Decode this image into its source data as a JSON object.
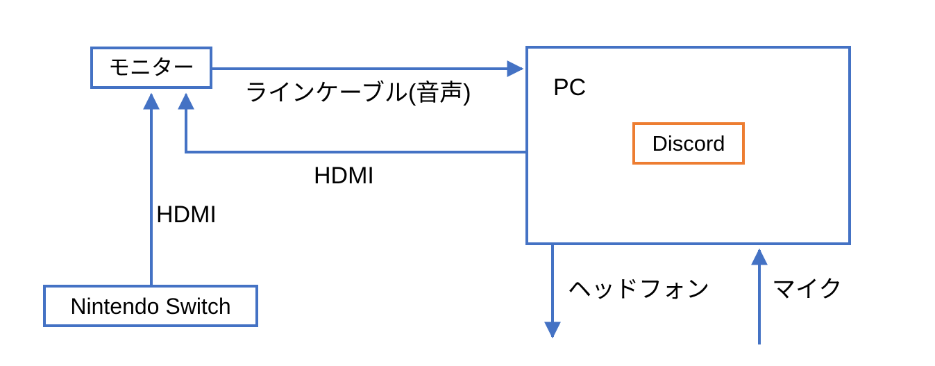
{
  "diagram": {
    "title": "PC / Monitor / Nintendo Switch connection diagram",
    "colors": {
      "box_blue": "#4472C4",
      "box_orange": "#ED7D31",
      "line_blue": "#4472C4",
      "text": "#000000",
      "background": "#FFFFFF"
    },
    "nodes": {
      "monitor": {
        "label": "モニター"
      },
      "pc": {
        "label": "PC"
      },
      "discord": {
        "label": "Discord"
      },
      "switch": {
        "label": "Nintendo Switch"
      }
    },
    "edges": {
      "line_cable_audio": {
        "label": "ラインケーブル(音声)",
        "from": "monitor",
        "to": "pc",
        "arrow": "to-pc"
      },
      "hdmi_pc_to_monitor": {
        "label": "HDMI",
        "from": "pc",
        "to": "monitor",
        "arrow": "to-monitor"
      },
      "hdmi_switch_to_monitor": {
        "label": "HDMI",
        "from": "switch",
        "to": "monitor",
        "arrow": "to-monitor"
      },
      "headphone": {
        "label": "ヘッドフォン",
        "from": "pc",
        "to": "headphone-out",
        "arrow": "down-out"
      },
      "mic": {
        "label": "マイク",
        "from": "mic-in",
        "to": "pc",
        "arrow": "up-into-pc"
      }
    }
  }
}
